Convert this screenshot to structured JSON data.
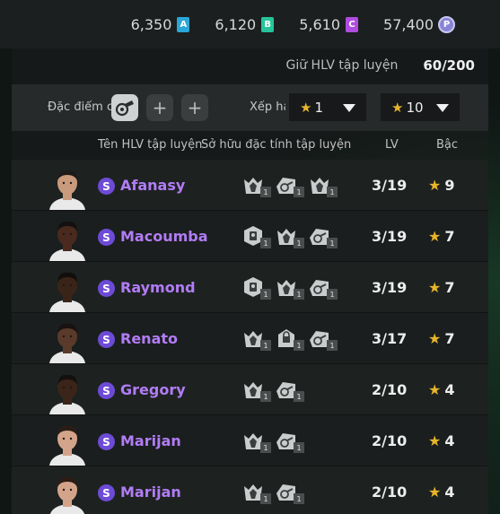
{
  "currencies": [
    {
      "value": "6,350",
      "badge": "A",
      "color": "#2aa7d8",
      "kind": "badge"
    },
    {
      "value": "6,120",
      "badge": "B",
      "color": "#27c49a",
      "kind": "badge"
    },
    {
      "value": "5,610",
      "badge": "C",
      "color": "#b04de0",
      "kind": "badge"
    },
    {
      "value": "57,400",
      "badge": "P",
      "color": "#8a84d8",
      "kind": "coin"
    }
  ],
  "capacity": {
    "label": "Giữ HLV tập luyện",
    "value": "60/200"
  },
  "filters": {
    "trait_label": "Đặc điểm c",
    "add_symbol": "+",
    "rank_label": "Xếp hạ",
    "range_sep": "~",
    "rank_min": "1",
    "rank_max": "10",
    "star": "★"
  },
  "columns": {
    "name": "Tên HLV tập luyện",
    "traits": "Sở hữu đặc tính tập luyện",
    "lv": "LV",
    "grade": "Bậc"
  },
  "coaches": [
    {
      "badge": "S",
      "name": "Afanasy",
      "traits": [
        {
          "icon": "arms-raised-icon",
          "level": "1"
        },
        {
          "icon": "whistle-icon",
          "level": "1"
        },
        {
          "icon": "arms-raised-icon",
          "level": "1"
        }
      ],
      "lv": "3/19",
      "grade": "9",
      "skin": "#c99a7c",
      "hair": "#1d1a18"
    },
    {
      "badge": "S",
      "name": "Macoumba",
      "traits": [
        {
          "icon": "clipboard-icon",
          "level": "1"
        },
        {
          "icon": "arms-raised-icon",
          "level": "1"
        },
        {
          "icon": "whistle-icon",
          "level": "1"
        }
      ],
      "lv": "3/19",
      "grade": "7",
      "skin": "#4a2a1e",
      "hair": "#141010"
    },
    {
      "badge": "S",
      "name": "Raymond",
      "traits": [
        {
          "icon": "clipboard-icon",
          "level": "1"
        },
        {
          "icon": "arms-raised-icon",
          "level": "1"
        },
        {
          "icon": "whistle-icon",
          "level": "1"
        }
      ],
      "lv": "3/19",
      "grade": "7",
      "skin": "#3a2418",
      "hair": "#120e0c"
    },
    {
      "badge": "S",
      "name": "Renato",
      "traits": [
        {
          "icon": "arms-raised-icon",
          "level": "1"
        },
        {
          "icon": "lock-icon",
          "level": "1"
        },
        {
          "icon": "whistle-icon",
          "level": "1"
        }
      ],
      "lv": "3/17",
      "grade": "7",
      "skin": "#5a3a2a",
      "hair": "#181210"
    },
    {
      "badge": "S",
      "name": "Gregory",
      "traits": [
        {
          "icon": "arms-raised-icon",
          "level": "1"
        },
        {
          "icon": "whistle-icon",
          "level": "1"
        }
      ],
      "lv": "2/10",
      "grade": "4",
      "skin": "#3b2418",
      "hair": "#141010"
    },
    {
      "badge": "S",
      "name": "Marijan",
      "traits": [
        {
          "icon": "arms-raised-icon",
          "level": "1"
        },
        {
          "icon": "whistle-icon",
          "level": "1"
        }
      ],
      "lv": "2/10",
      "grade": "4",
      "skin": "#d4a48a",
      "hair": "#2b1d16"
    },
    {
      "badge": "S",
      "name": "Marijan",
      "traits": [
        {
          "icon": "arms-raised-icon",
          "level": "1"
        },
        {
          "icon": "whistle-icon",
          "level": "1"
        }
      ],
      "lv": "2/10",
      "grade": "4",
      "skin": "#d4a48a",
      "hair": "#2b1d16"
    }
  ]
}
